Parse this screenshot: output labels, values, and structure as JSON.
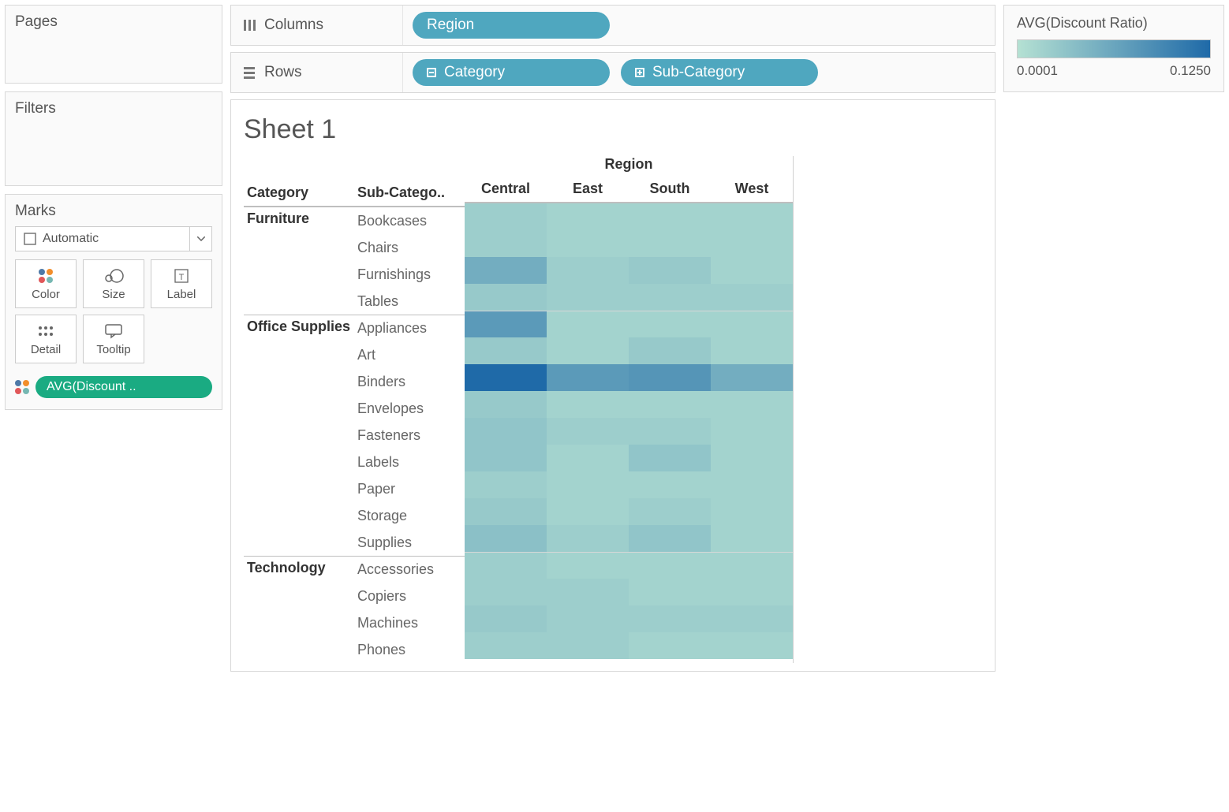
{
  "panels": {
    "pages": "Pages",
    "filters": "Filters",
    "marks": "Marks"
  },
  "marks": {
    "type_selected": "Automatic",
    "buttons": {
      "color": "Color",
      "size": "Size",
      "label": "Label",
      "detail": "Detail",
      "tooltip": "Tooltip"
    },
    "color_pill": "AVG(Discount .."
  },
  "shelves": {
    "columns_label": "Columns",
    "rows_label": "Rows",
    "columns_pills": [
      "Region"
    ],
    "rows_pills": [
      {
        "label": "Category",
        "icon": "minus"
      },
      {
        "label": "Sub-Category",
        "icon": "plus"
      }
    ]
  },
  "viz": {
    "title": "Sheet 1",
    "region_header": "Region",
    "col_headers": {
      "category": "Category",
      "subcategory": "Sub-Catego.."
    }
  },
  "legend": {
    "title": "AVG(Discount Ratio)",
    "min": "0.0001",
    "max": "0.1250"
  },
  "chart_data": {
    "type": "heatmap",
    "title": "Sheet 1",
    "measure": "AVG(Discount Ratio)",
    "xlabel": "Region",
    "row_dimensions": [
      "Category",
      "Sub-Category"
    ],
    "x": [
      "Central",
      "East",
      "South",
      "West"
    ],
    "color_scale": {
      "min": 0.0001,
      "max": 0.125,
      "low_color": "#b5e1d3",
      "high_color": "#1f6aa8"
    },
    "rows": [
      {
        "category": "Furniture",
        "subcategory": "Bookcases",
        "values": [
          0.02,
          0.015,
          0.015,
          0.015
        ]
      },
      {
        "category": "Furniture",
        "subcategory": "Chairs",
        "values": [
          0.02,
          0.015,
          0.015,
          0.015
        ]
      },
      {
        "category": "Furniture",
        "subcategory": "Furnishings",
        "values": [
          0.055,
          0.02,
          0.025,
          0.015
        ]
      },
      {
        "category": "Furniture",
        "subcategory": "Tables",
        "values": [
          0.025,
          0.02,
          0.02,
          0.02
        ]
      },
      {
        "category": "Office Supplies",
        "subcategory": "Appliances",
        "values": [
          0.075,
          0.015,
          0.015,
          0.015
        ]
      },
      {
        "category": "Office Supplies",
        "subcategory": "Art",
        "values": [
          0.025,
          0.015,
          0.025,
          0.015
        ]
      },
      {
        "category": "Office Supplies",
        "subcategory": "Binders",
        "values": [
          0.125,
          0.075,
          0.08,
          0.055
        ]
      },
      {
        "category": "Office Supplies",
        "subcategory": "Envelopes",
        "values": [
          0.025,
          0.015,
          0.015,
          0.015
        ]
      },
      {
        "category": "Office Supplies",
        "subcategory": "Fasteners",
        "values": [
          0.03,
          0.02,
          0.02,
          0.015
        ]
      },
      {
        "category": "Office Supplies",
        "subcategory": "Labels",
        "values": [
          0.03,
          0.015,
          0.03,
          0.015
        ]
      },
      {
        "category": "Office Supplies",
        "subcategory": "Paper",
        "values": [
          0.02,
          0.015,
          0.015,
          0.015
        ]
      },
      {
        "category": "Office Supplies",
        "subcategory": "Storage",
        "values": [
          0.025,
          0.015,
          0.02,
          0.015
        ]
      },
      {
        "category": "Office Supplies",
        "subcategory": "Supplies",
        "values": [
          0.035,
          0.02,
          0.03,
          0.015
        ]
      },
      {
        "category": "Technology",
        "subcategory": "Accessories",
        "values": [
          0.02,
          0.015,
          0.015,
          0.015
        ]
      },
      {
        "category": "Technology",
        "subcategory": "Copiers",
        "values": [
          0.02,
          0.02,
          0.015,
          0.015
        ]
      },
      {
        "category": "Technology",
        "subcategory": "Machines",
        "values": [
          0.025,
          0.02,
          0.02,
          0.02
        ]
      },
      {
        "category": "Technology",
        "subcategory": "Phones",
        "values": [
          0.02,
          0.02,
          0.015,
          0.015
        ]
      }
    ]
  }
}
